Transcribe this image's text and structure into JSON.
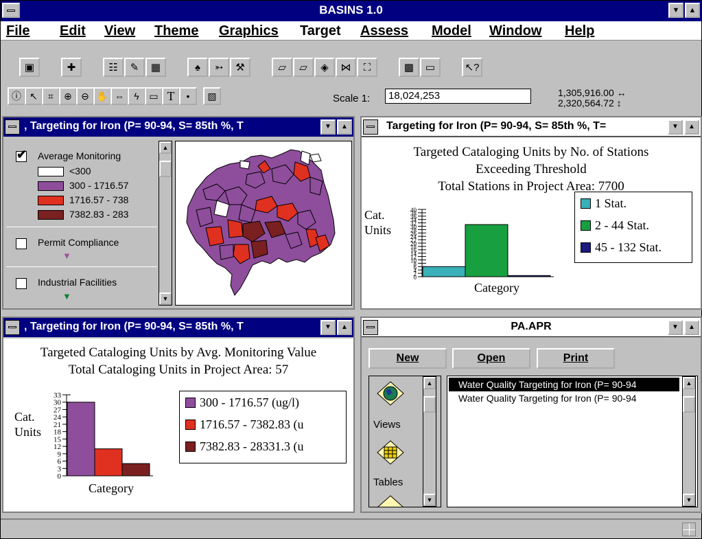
{
  "app": {
    "title": "BASINS 1.0"
  },
  "menu": [
    {
      "label": "File"
    },
    {
      "label": "Edit"
    },
    {
      "label": "View"
    },
    {
      "label": "Theme"
    },
    {
      "label": "Graphics"
    },
    {
      "label": "Target"
    },
    {
      "label": "Assess"
    },
    {
      "label": "Model"
    },
    {
      "label": "Window"
    },
    {
      "label": "Help"
    }
  ],
  "toolbar2": {
    "scale_label": "Scale 1:",
    "scale_value": "18,024,253",
    "coord_x": "1,305,916.00",
    "coord_y": "2,320,564.72",
    "coord_x_arrow": "↔",
    "coord_y_arrow": "↕"
  },
  "map_window": {
    "title": "Targeting for Iron (P= 90-94, S= 85th %, T",
    "legend": {
      "layer1": "Average Monitoring",
      "classes": [
        {
          "label": "<300",
          "color": "#ffffff"
        },
        {
          "label": "300 - 1716.57",
          "color": "#8e4e9c"
        },
        {
          "label": "1716.57 - 738",
          "color": "#e03020"
        },
        {
          "label": "7382.83 - 283",
          "color": "#7a2020"
        }
      ],
      "layer2": "Permit Compliance",
      "layer2_marker": "▼",
      "layer3": "Industrial Facilities",
      "layer3_marker": "▼"
    }
  },
  "chart1_window": {
    "title": "Targeting for Iron (P= 90-94, S= 85th %, T=",
    "title1": "Targeted Cataloging Units by No. of Stations",
    "title2": "Exceeding Threshold",
    "title3": "Total Stations in Project Area: 7700",
    "ylabel1": "Cat.",
    "ylabel2": "Units",
    "xlabel": "Category"
  },
  "chart2_window": {
    "title": "Targeting for Iron (P= 90-94, S= 85th %, T",
    "title1": "Targeted Cataloging Units by Avg. Monitoring Value",
    "title2": "Total Cataloging Units in Project Area: 57",
    "ylabel1": "Cat.",
    "ylabel2": "Units",
    "xlabel": "Category"
  },
  "project_window": {
    "title": "PA.APR",
    "buttons": {
      "new": "New",
      "open": "Open",
      "print": "Print"
    },
    "icons": [
      {
        "label": "Views"
      },
      {
        "label": "Tables"
      }
    ],
    "items": [
      "Water Quality Targeting for Iron (P= 90-94",
      "Water Quality Targeting for Iron (P= 90-94"
    ]
  },
  "chart_data": [
    {
      "type": "bar",
      "title": "Targeted Cataloging Units by No. of Stations Exceeding Threshold",
      "subtitle": "Total Stations in Project Area: 7700",
      "ylabel": "Cat. Units",
      "xlabel": "Category",
      "ylim": [
        0,
        40
      ],
      "yticks": [
        0,
        2,
        4,
        6,
        8,
        10,
        12,
        14,
        16,
        18,
        20,
        22,
        24,
        26,
        28,
        30,
        32,
        34,
        36,
        38,
        40
      ],
      "legend_position": "right",
      "series": [
        {
          "name": "1 Stat.",
          "value": 6,
          "color": "#3ab0b8"
        },
        {
          "name": "2 - 44 Stat.",
          "value": 31,
          "color": "#18a040"
        },
        {
          "name": "45 - 132 Stat.",
          "value": 0.7,
          "color": "#1a1a80"
        }
      ]
    },
    {
      "type": "bar",
      "title": "Targeted Cataloging Units by Avg. Monitoring Value",
      "subtitle": "Total Cataloging Units in Project Area: 57",
      "ylabel": "Cat. Units",
      "xlabel": "Category",
      "ylim": [
        0,
        33
      ],
      "yticks": [
        0,
        3,
        6,
        9,
        12,
        15,
        18,
        21,
        24,
        27,
        30,
        33
      ],
      "legend_position": "right",
      "series": [
        {
          "name": "300 - 1716.57 (ug/l)",
          "value": 30,
          "color": "#8e4e9c"
        },
        {
          "name": "1716.57 - 7382.83 (u",
          "value": 11,
          "color": "#e03020"
        },
        {
          "name": "7382.83 - 28331.3 (u",
          "value": 5,
          "color": "#7a2020"
        }
      ]
    }
  ]
}
